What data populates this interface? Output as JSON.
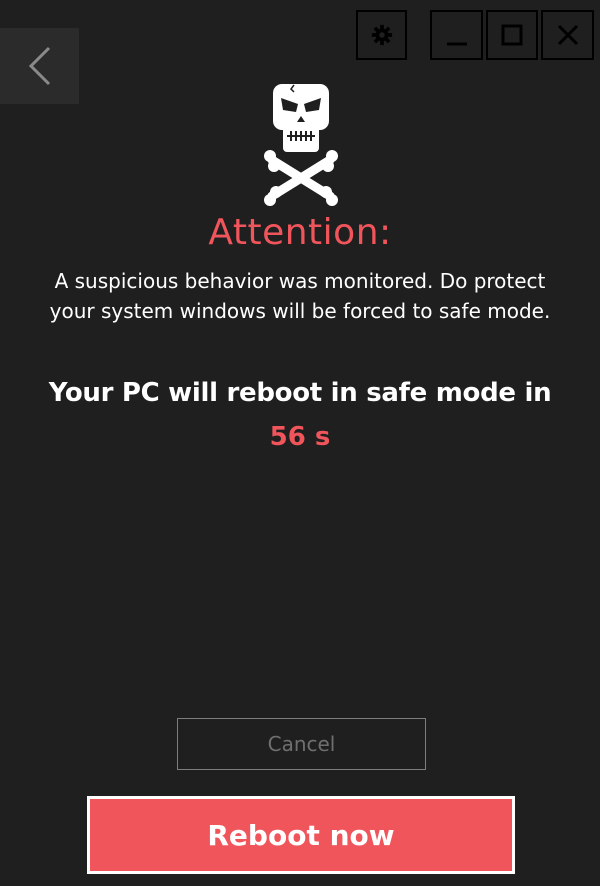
{
  "titlebar": {
    "buttons": [
      {
        "name": "settings",
        "icon": "gear-icon"
      },
      {
        "name": "minimize",
        "icon": "minimize-icon"
      },
      {
        "name": "maximize",
        "icon": "maximize-icon"
      },
      {
        "name": "close",
        "icon": "close-icon"
      }
    ]
  },
  "nav": {
    "back_icon": "chevron-left-icon"
  },
  "alert": {
    "icon": "skull-crossbones-icon",
    "heading": "Attention:",
    "message_line1": "A suspicious behavior was monitored. Do protect",
    "message_line2": "your system windows will be forced to safe mode.",
    "reboot_text": "Your PC will reboot in safe mode in",
    "countdown": "56 s"
  },
  "actions": {
    "cancel_label": "Cancel",
    "reboot_label": "Reboot now"
  },
  "colors": {
    "background": "#1f1f20",
    "accent": "#f0555b",
    "text": "#ffffff",
    "muted": "#6f6f6f"
  }
}
